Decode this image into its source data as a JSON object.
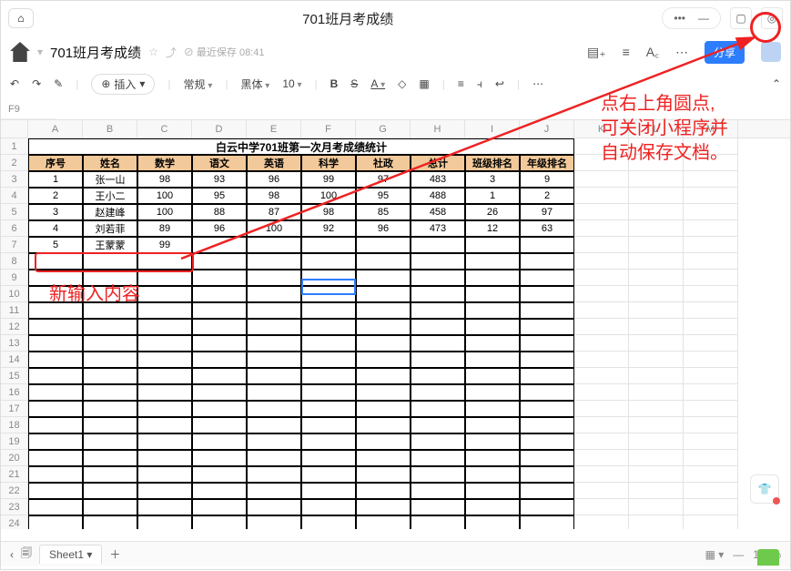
{
  "window": {
    "title": "701班月考成绩"
  },
  "doc": {
    "title": "701班月考成绩",
    "saved_prefix": "最近保存",
    "saved_time": "08:41",
    "share": "分享"
  },
  "cellref": "F9",
  "toolbar": {
    "insert": "插入",
    "style": "常规",
    "black": "黑体",
    "size": "10",
    "bold": "B",
    "underline": "S",
    "align": "A"
  },
  "columns": [
    "A",
    "B",
    "C",
    "D",
    "E",
    "F",
    "G",
    "H",
    "I",
    "J",
    "K",
    "L",
    "M"
  ],
  "sheet_title": "白云中学701班第一次月考成绩统计",
  "headers": [
    "序号",
    "姓名",
    "数学",
    "语文",
    "英语",
    "科学",
    "社政",
    "总计",
    "班级排名",
    "年级排名"
  ],
  "rows": [
    [
      "1",
      "张一山",
      "98",
      "93",
      "96",
      "99",
      "97",
      "483",
      "3",
      "9"
    ],
    [
      "2",
      "王小二",
      "100",
      "95",
      "98",
      "100",
      "95",
      "488",
      "1",
      "2"
    ],
    [
      "3",
      "赵建峰",
      "100",
      "88",
      "87",
      "98",
      "85",
      "458",
      "26",
      "97"
    ],
    [
      "4",
      "刘若菲",
      "89",
      "96",
      "100",
      "92",
      "96",
      "473",
      "12",
      "63"
    ],
    [
      "5",
      "王蒙蒙",
      "99",
      "",
      "",
      "",
      "",
      "",
      "",
      ""
    ]
  ],
  "tab": {
    "name": "Sheet1",
    "zoom": "100%"
  },
  "annotations": {
    "callout_line1": "点右上角圆点,",
    "callout_line2": "可关闭小程序并",
    "callout_line3": "自动保存文档。",
    "newinput": "新输入内容"
  }
}
